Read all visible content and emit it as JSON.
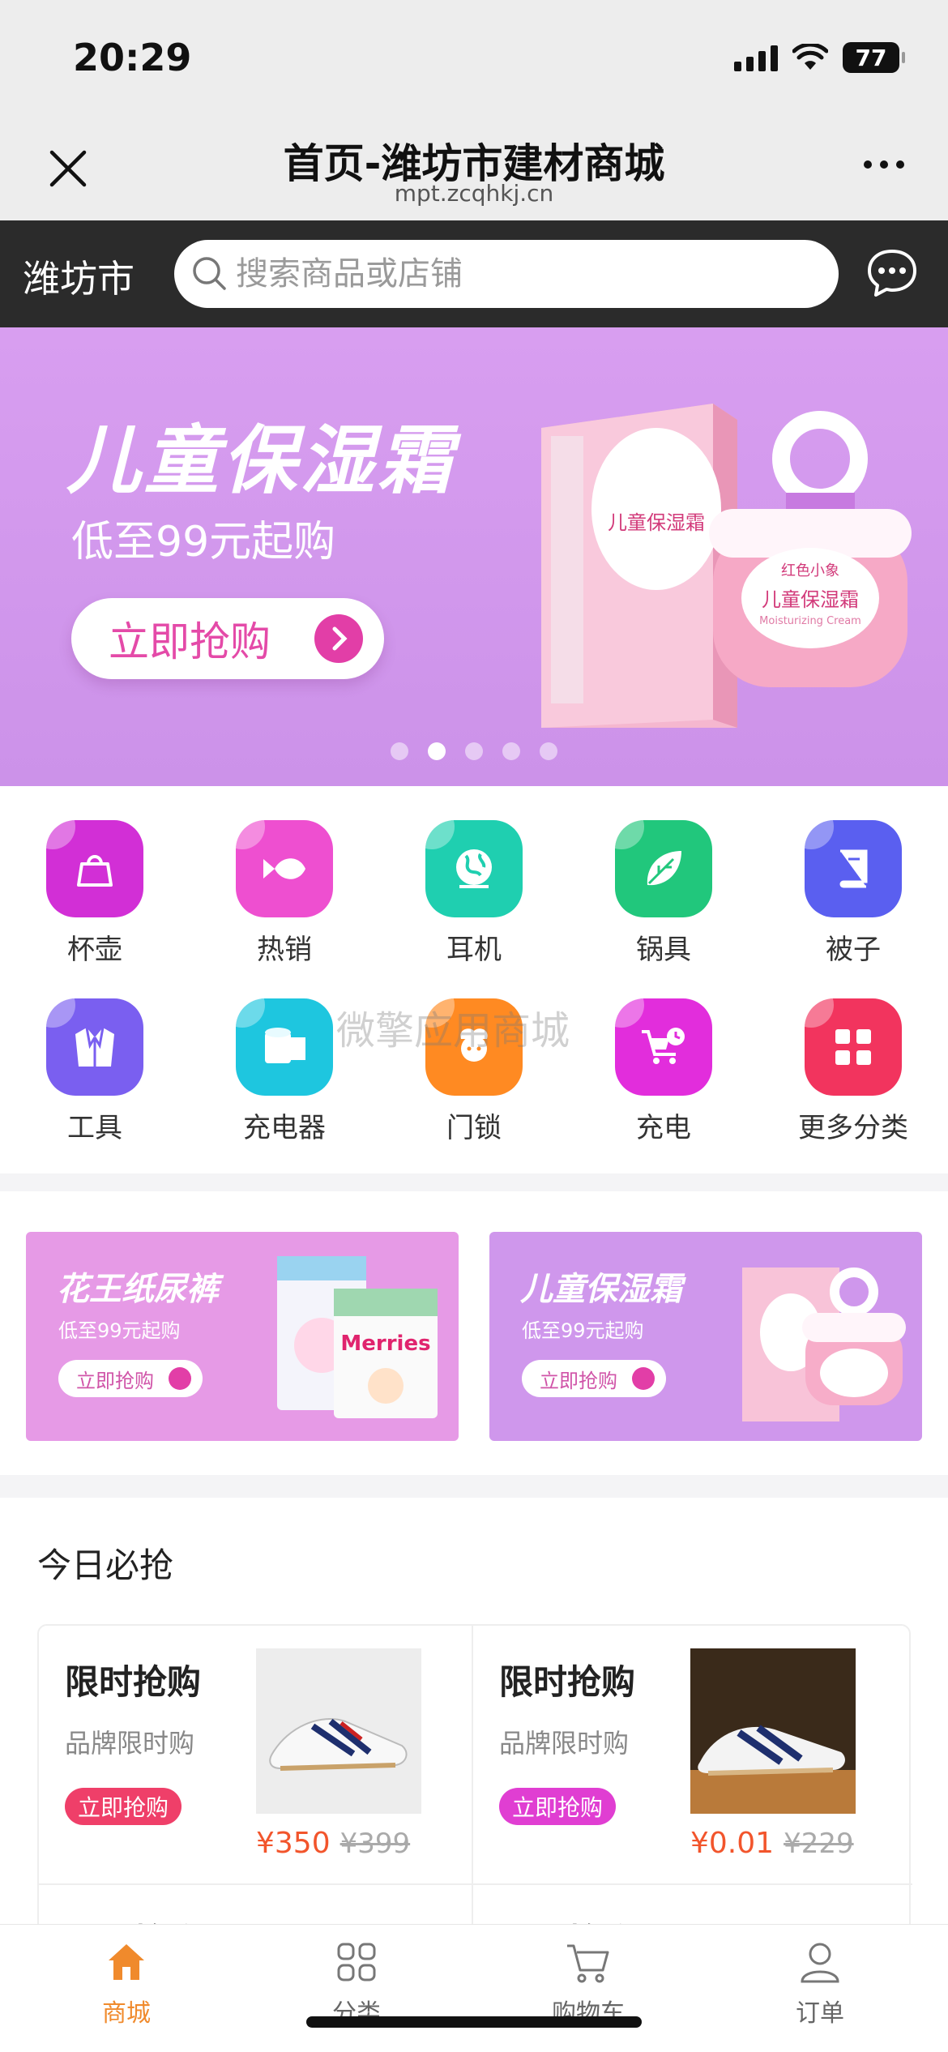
{
  "status": {
    "time": "20:29",
    "battery": "77"
  },
  "nav": {
    "title": "首页-潍坊市建材商城",
    "subtitle": "mpt.zcqhkj.cn"
  },
  "search": {
    "city": "潍坊市",
    "placeholder": "搜索商品或店铺"
  },
  "banner": {
    "title": "儿童保湿霜",
    "subtitle": "低至99元起购",
    "button": "立即抢购",
    "pack_brand": "红色小象",
    "pack_product": "儿童保湿霜",
    "pack_product_en": "Moisturizing Cream",
    "slides": 5,
    "active_slide": 2
  },
  "categories": [
    {
      "label": "杯壶",
      "icon": "bag-icon",
      "color": "#d22fd6"
    },
    {
      "label": "热销",
      "icon": "fish-icon",
      "color": "#ee4fd0"
    },
    {
      "label": "耳机",
      "icon": "globe-icon",
      "color": "#1fcfb0"
    },
    {
      "label": "锅具",
      "icon": "leaf-icon",
      "color": "#21c77c"
    },
    {
      "label": "被子",
      "icon": "book-icon",
      "color": "#5a5ff0"
    },
    {
      "label": "工具",
      "icon": "suit-icon",
      "color": "#7a5ff0"
    },
    {
      "label": "充电器",
      "icon": "tissue-icon",
      "color": "#1ec6df"
    },
    {
      "label": "门锁",
      "icon": "chef-icon",
      "color": "#ff8a22"
    },
    {
      "label": "充电",
      "icon": "cart-clock-icon",
      "color": "#e22ddc"
    },
    {
      "label": "更多分类",
      "icon": "grid-icon",
      "color": "#f2345e"
    }
  ],
  "watermark": "微擎应用商城",
  "promos": [
    {
      "title": "花王纸尿裤",
      "subtitle": "低至99元起购",
      "button": "立即抢购",
      "brand": "Merries",
      "color": "#e69ae6"
    },
    {
      "title": "儿童保湿霜",
      "subtitle": "低至99元起购",
      "button": "立即抢购",
      "color": "#cf97ec"
    }
  ],
  "today": {
    "title": "今日必抢",
    "items": [
      {
        "title": "限时抢购",
        "subtitle": "品牌限时购",
        "button": "立即抢购",
        "button_color": "#ef3f69",
        "price": "¥350",
        "old_price": "¥399"
      },
      {
        "title": "限时抢购",
        "subtitle": "品牌限时购",
        "button": "立即抢购",
        "button_color": "#e03ed2",
        "price": "¥0.01",
        "old_price": "¥229"
      },
      {
        "title": "限时抢购"
      },
      {
        "title": "限时抢购"
      }
    ]
  },
  "tabs": [
    {
      "label": "商城",
      "icon": "home-icon",
      "active": true
    },
    {
      "label": "分类",
      "icon": "grid-icon",
      "active": false
    },
    {
      "label": "购物车",
      "icon": "cart-icon",
      "active": false
    },
    {
      "label": "订单",
      "icon": "user-icon",
      "active": false
    }
  ],
  "colors": {
    "accent": "#f08a2c",
    "header_dark": "#2b2b2b",
    "banner": "#d89ef0",
    "price": "#f2552c"
  }
}
